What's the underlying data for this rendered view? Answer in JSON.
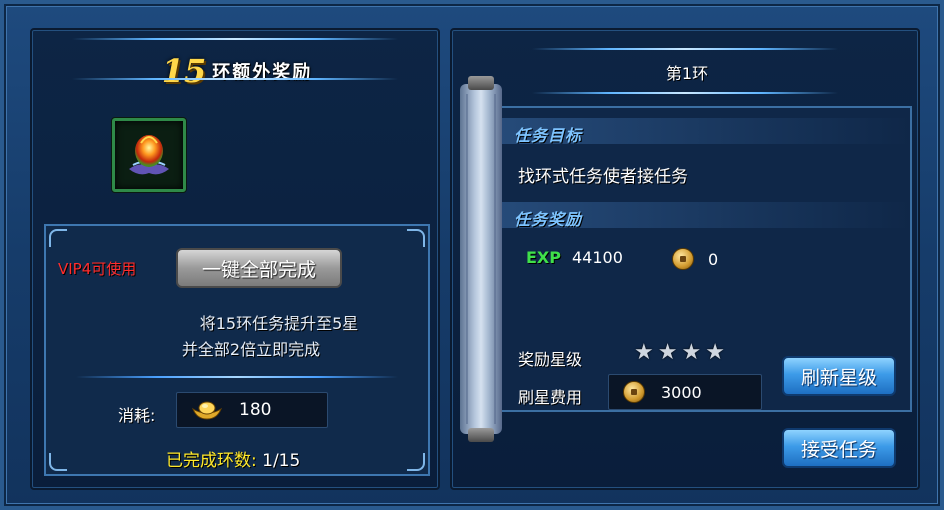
{
  "left_panel": {
    "bonus_number": "15",
    "bonus_title": "环额外奖励",
    "vip_label": "VIP4可使用",
    "complete_all_button": "一键全部完成",
    "description_line1": "将15环任务提升至5星",
    "description_line2": "并全部2倍立即完成",
    "cost_label": "消耗:",
    "cost_value": "180",
    "completed_label": "已完成环数:",
    "completed_count": "1/15"
  },
  "right_panel": {
    "ring_title": "第1环",
    "task_goal_title": "任务目标",
    "task_goal_text": "找环式任务使者接任务",
    "task_reward_title": "任务奖励",
    "exp_label": "EXP",
    "exp_value": "44100",
    "coin_value": "0",
    "star_label": "奖励星级",
    "star_rating": 4,
    "refresh_fee_label": "刷星费用",
    "refresh_fee_value": "3000",
    "refresh_button": "刷新星级",
    "accept_button": "接受任务"
  },
  "icons": {
    "reward_item": "fire-flower-icon",
    "gold_ingot": "gold-ingot-icon",
    "coin": "copper-coin-icon",
    "star": "star-icon"
  },
  "colors": {
    "vip_red": "#ff2d2d",
    "completed_yellow": "#ffe82a",
    "exp_green": "#3fe04a",
    "section_blue": "#7ec4ff"
  }
}
